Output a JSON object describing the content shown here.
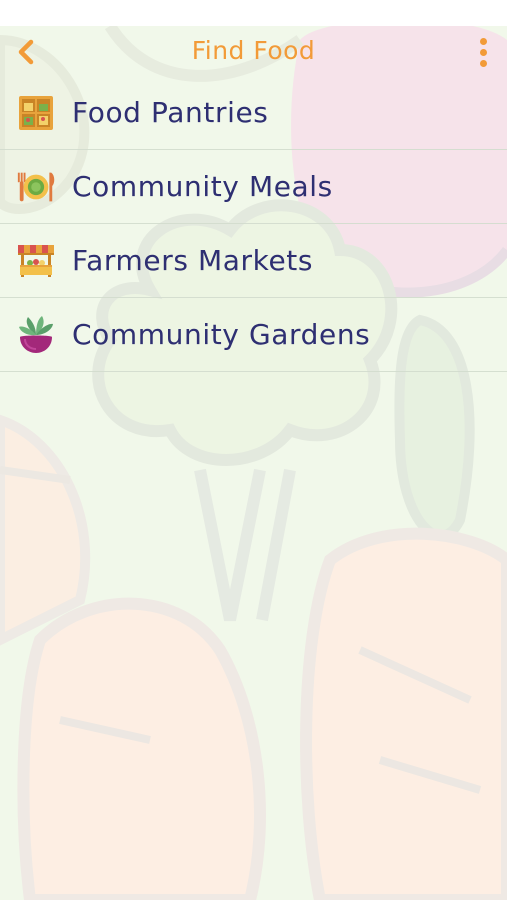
{
  "header": {
    "title": "Find Food",
    "back_icon": "chevron-left-icon",
    "menu_icon": "more-vertical-icon"
  },
  "menu": {
    "items": [
      {
        "label": "Food Pantries",
        "icon": "pantry-shelves-icon"
      },
      {
        "label": "Community Meals",
        "icon": "plate-utensils-icon"
      },
      {
        "label": "Farmers Markets",
        "icon": "market-stall-icon"
      },
      {
        "label": "Community Gardens",
        "icon": "beet-icon"
      }
    ]
  },
  "colors": {
    "accent": "#f29b38",
    "text": "#2e2f72",
    "background": "#f1f8ea"
  }
}
